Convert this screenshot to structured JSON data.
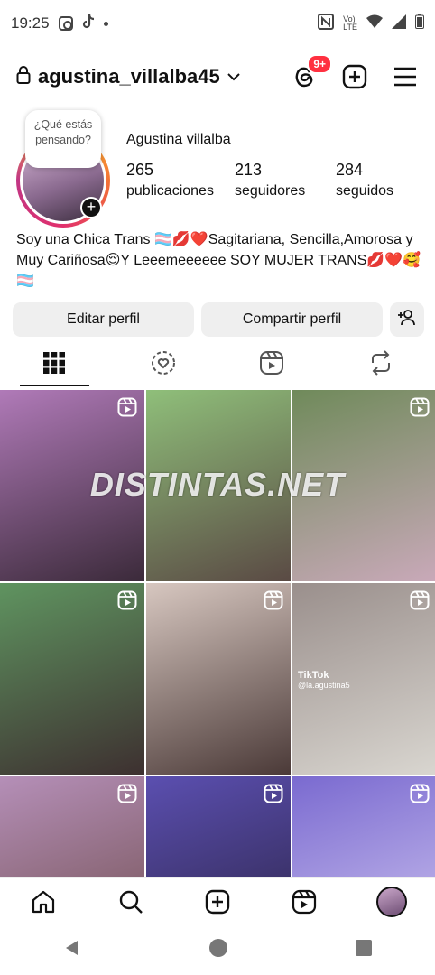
{
  "status": {
    "time": "19:25"
  },
  "header": {
    "username": "agustina_villalba45",
    "notifications_badge": "9+"
  },
  "profile": {
    "note_bubble": "¿Qué estás pensando?",
    "full_name": "Agustina villalba",
    "stats": [
      {
        "value": "265",
        "label": "publicaciones"
      },
      {
        "value": "213",
        "label": "seguidores"
      },
      {
        "value": "284",
        "label": "seguidos"
      }
    ],
    "bio": "Soy una Chica Trans 🏳️‍⚧️💋❤️Sagitariana, Sencilla,Amorosa y Muy Cariñosa😌Y Leeemeeeeee SOY MUJER TRANS💋❤️🥰🏳️‍⚧️"
  },
  "actions": {
    "edit": "Editar perfil",
    "share": "Compartir perfil"
  },
  "tabs": [
    {
      "icon": "grid-icon",
      "active": true
    },
    {
      "icon": "heart-circle-icon",
      "active": false
    },
    {
      "icon": "reels-icon",
      "active": false
    },
    {
      "icon": "repost-icon",
      "active": false
    }
  ],
  "watermark": "DISTINTAS.NET",
  "grid": [
    {
      "colors": [
        "#b07ab8",
        "#3b2a3a"
      ],
      "reel": true
    },
    {
      "colors": [
        "#8fbf7a",
        "#5a4a44"
      ],
      "reel": false
    },
    {
      "colors": [
        "#6f8a5a",
        "#c9a9b9"
      ],
      "reel": true
    },
    {
      "colors": [
        "#5f9460",
        "#3d3030"
      ],
      "reel": true
    },
    {
      "colors": [
        "#d7c7c0",
        "#4b3a38"
      ],
      "reel": true
    },
    {
      "colors": [
        "#9a8f8c",
        "#d9d6d0"
      ],
      "reel": true,
      "tiktok": "TikTok",
      "tiktok_user": "@la.agustina5"
    },
    {
      "colors": [
        "#b58fb8",
        "#6f4d4d"
      ],
      "reel": true
    },
    {
      "colors": [
        "#5b4fb0",
        "#2a2244"
      ],
      "reel": true
    },
    {
      "colors": [
        "#7a6ad0",
        "#d0c6f0"
      ],
      "reel": true
    }
  ],
  "bottom_nav": [
    "home-icon",
    "search-icon",
    "create-icon",
    "reels-icon",
    "profile-avatar"
  ]
}
